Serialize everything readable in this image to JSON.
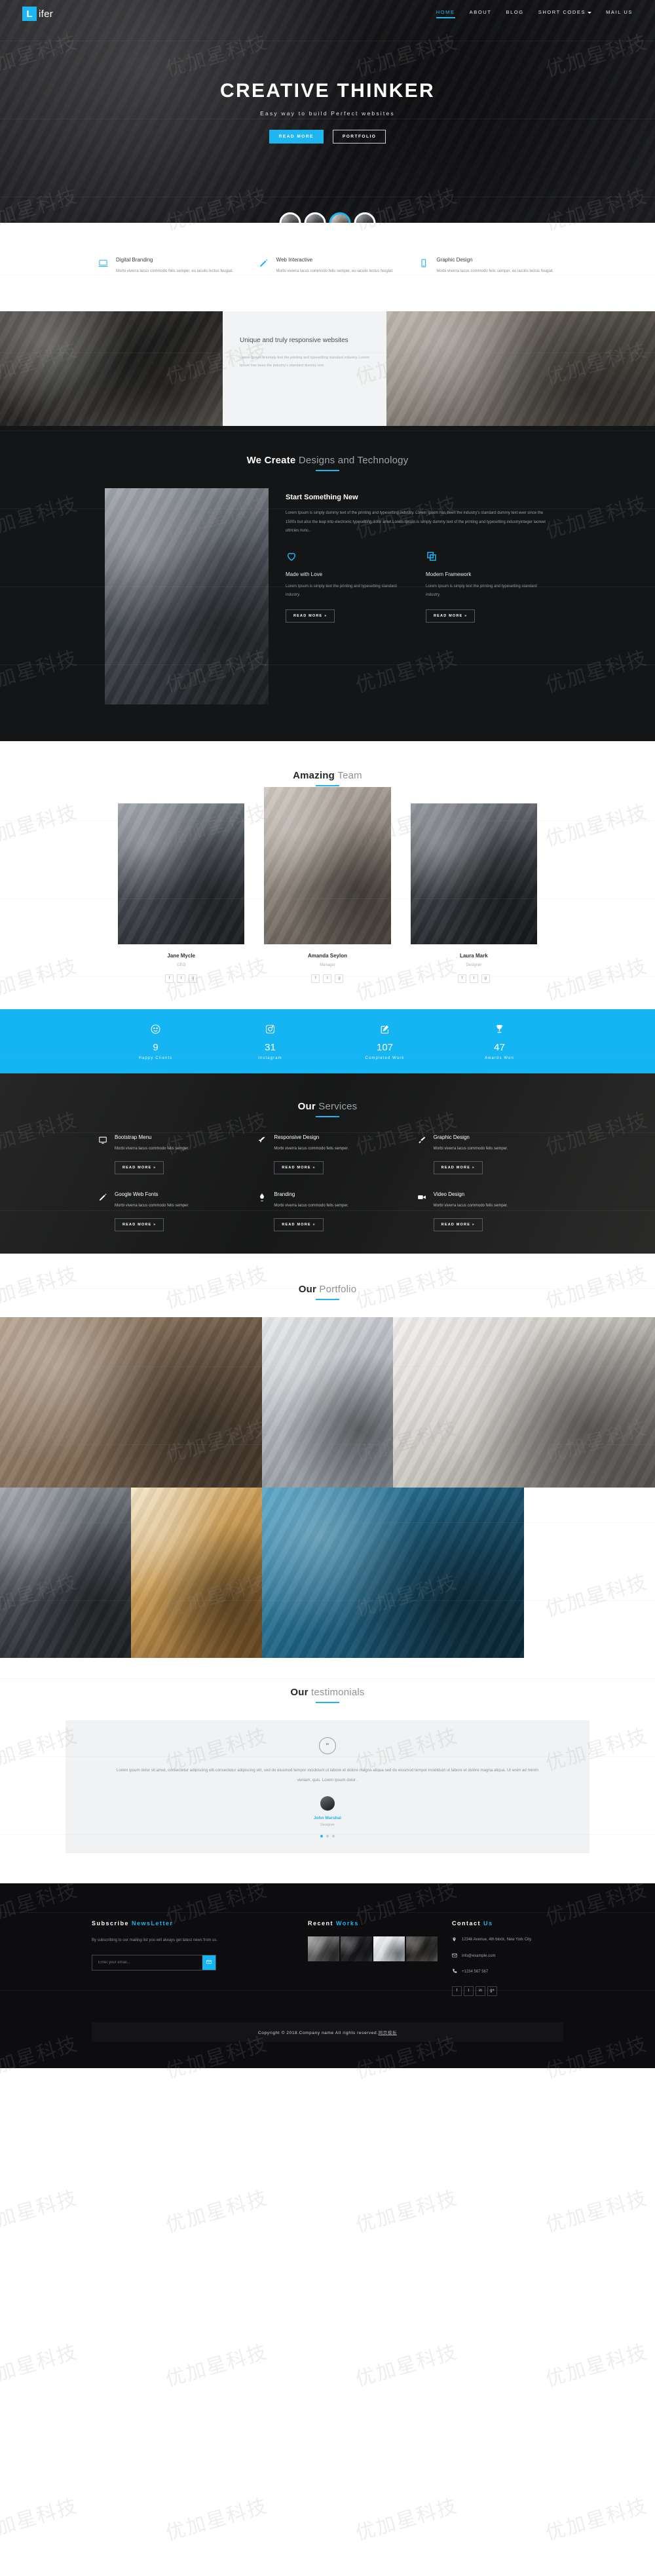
{
  "brand": {
    "logo_letter": "L",
    "logo_text": "ifer"
  },
  "nav": {
    "items": [
      {
        "label": "HOME",
        "active": true,
        "caret": false
      },
      {
        "label": "ABOUT",
        "active": false,
        "caret": false
      },
      {
        "label": "BLOG",
        "active": false,
        "caret": false
      },
      {
        "label": "SHORT CODES",
        "active": false,
        "caret": true
      },
      {
        "label": "MAIL US",
        "active": false,
        "caret": false
      }
    ]
  },
  "hero": {
    "title": "CREATIVE THINKER",
    "subtitle": "Easy way to build Perfect websites",
    "btn_primary": "READ MORE",
    "btn_secondary": "PORTFOLIO",
    "accent": "#1eb5f0"
  },
  "features": {
    "items": [
      {
        "icon": "laptop-icon",
        "title": "Digital Branding",
        "text": "Morbi viverra lacus commodo felis semper, eu iaculis lectus feugiat."
      },
      {
        "icon": "pencil-icon",
        "title": "Web Interactive",
        "text": "Morbi viverra lacus commodo felis semper, eu iaculis lectus feugiat."
      },
      {
        "icon": "mobile-icon",
        "title": "Graphic Design",
        "text": "Morbi viverra lacus commodo felis semper, eu iaculis lectus feugiat."
      }
    ]
  },
  "responsive_band": {
    "title": "Unique and truly responsive websites",
    "text": "Lorem Ipsum is simply text the printing and typesetting standard industry. Lorem Ipsum has been the industry's standard dummy text."
  },
  "we_create": {
    "title_bold": "We Create",
    "title_light": "Designs and Technology",
    "heading": "Start Something New",
    "paragraph": "Lorem Ipsum is simply dummy text of the printing and typesetting industry. Lorem Ipsum has been the industry's standard dummy text ever since the 1500s but also the leap into electronic typesetting dolor amet.Lorem Ipsum is simply dummy text of the printing and typesetting industryinteger laoreet ultricies nunc..",
    "cards": [
      {
        "icon": "heart-icon",
        "title": "Made with Love",
        "text": "Lorem Ipsum is simply text the printing and typesetting standard industry.",
        "button": "READ MORE »"
      },
      {
        "icon": "layers-copy-icon",
        "title": "Modern Framework",
        "text": "Lorem Ipsum is simply text the printing and typesetting standard industry.",
        "button": "READ MORE »"
      }
    ]
  },
  "team": {
    "title_bold": "Amazing",
    "title_light": "Team",
    "members": [
      {
        "name": "Jane Mycle",
        "role": "CEO",
        "socials": [
          "f",
          "t",
          "g"
        ]
      },
      {
        "name": "Amanda Seylon",
        "role": "Manager",
        "socials": [
          "f",
          "t",
          "g"
        ]
      },
      {
        "name": "Laura Mark",
        "role": "Designer",
        "socials": [
          "f",
          "t",
          "g"
        ]
      }
    ]
  },
  "stats": {
    "bg": "#15b4f2",
    "items": [
      {
        "icon": "smiley-icon",
        "value": "9",
        "label": "Happy Clients"
      },
      {
        "icon": "instagram-icon",
        "value": "31",
        "label": "Instagram"
      },
      {
        "icon": "edit-square-icon",
        "value": "107",
        "label": "Completed Work"
      },
      {
        "icon": "trophy-icon",
        "value": "47",
        "label": "Awards Won"
      }
    ]
  },
  "services": {
    "title_bold": "Our",
    "title_light": "Services",
    "items": [
      {
        "icon": "monitor-icon",
        "title": "Bootstrap Menu",
        "text": "Morbi viverra lacus commodo felis semper.",
        "button": "READ MORE »"
      },
      {
        "icon": "rocket-icon",
        "title": "Responsive Design",
        "text": "Morbi viverra lacus commodo felis semper.",
        "button": "READ MORE »"
      },
      {
        "icon": "brush-icon",
        "title": "Graphic Design",
        "text": "Morbi viverra lacus commodo felis semper.",
        "button": "READ MORE »"
      },
      {
        "icon": "pencil-icon",
        "title": "Google Web Fonts",
        "text": "Morbi viverra lacus commodo felis semper.",
        "button": "READ MORE »"
      },
      {
        "icon": "flame-icon",
        "title": "Branding",
        "text": "Morbi viverra lacus commodo felis semper.",
        "button": "READ MORE »"
      },
      {
        "icon": "video-camera-icon",
        "title": "Video Design",
        "text": "Morbi viverra lacus commodo felis semper.",
        "button": "READ MORE »"
      }
    ]
  },
  "portfolio": {
    "title_bold": "Our",
    "title_light": "Portfolio",
    "tiles": [
      "leather-bag-photo",
      "dental-tools-photo",
      "coffee-desk-photo",
      "man-whiteboard-photo",
      "donut-sweets-photo",
      "glasses-phone-photo"
    ]
  },
  "testimonials": {
    "title_bold": "Our",
    "title_light": "testimonials",
    "quote_icon": "quote-icon",
    "quote": "Lorem ipsum dolor sit amet, consectetur adipiscing elit.consectetur adipiscing elit, sed do eiusmod tempor incididunt ut labore et dolore magna aliqua sed do eiusmod tempor incididunt ut labore et dolore magna aliqua. Ut enim ad minim veniam, quis. Lorem ipsum dolor .",
    "author": "John Marshal",
    "author_role": "Designer",
    "dots": 3,
    "active_dot": 0
  },
  "footer": {
    "subscribe": {
      "head_a": "Subscribe",
      "head_b": "NewsLetter",
      "text": "By subscribing to our mailing list you will always get latest news from us.",
      "placeholder": "Enter your email...",
      "submit_icon": "mail-icon"
    },
    "recent": {
      "head_a": "Recent",
      "head_b": "Works",
      "thumbs": [
        "work-thumb-1",
        "work-thumb-2",
        "work-thumb-3",
        "work-thumb-4"
      ]
    },
    "contact": {
      "head_a": "Contact",
      "head_b": "Us",
      "address": "1234k Avenue, 4th block, New York City.",
      "email": "info@example.com",
      "phone": "+1234 567 567",
      "socials": [
        "f",
        "t",
        "in",
        "g+"
      ]
    },
    "copyright": "Copyright © 2018.Company name All rights reserved.",
    "copyright_link": "网页模板"
  },
  "watermark": "优加星科技"
}
